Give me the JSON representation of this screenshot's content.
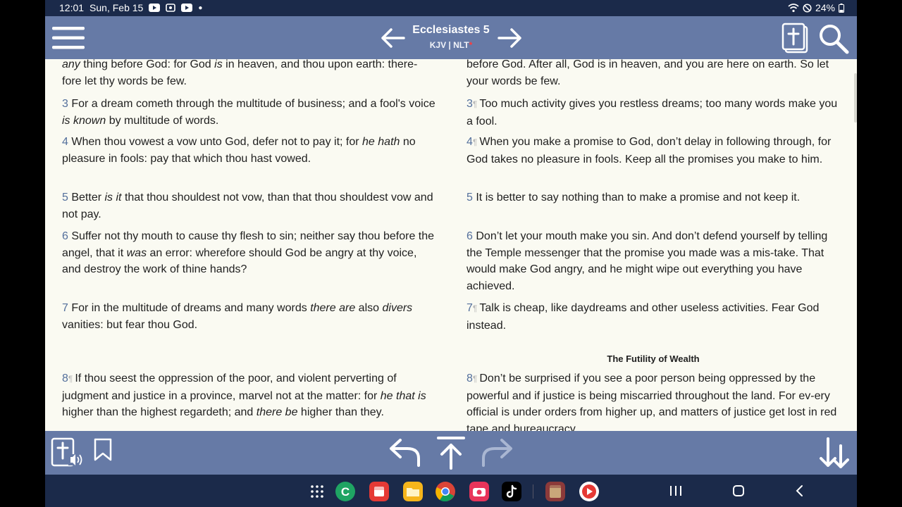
{
  "status_bar": {
    "time": "12:01",
    "date": "Sun, Feb 15",
    "battery": "24%"
  },
  "top_bar": {
    "chapter_title": "Ecclesiastes 5",
    "versions": "KJV | NLT",
    "version_marker": "*",
    "icons": [
      "menu-icon",
      "arrow-left-icon",
      "arrow-right-icon",
      "bible-book-icon",
      "search-icon"
    ]
  },
  "passage": {
    "kjv": [
      {
        "num": "",
        "html": "<i>any</i> thing before God: for God <i>is</i> in heaven, and thou upon earth: there-fore let thy words be few."
      },
      {
        "num": "3",
        "html": "For a dream cometh through the multitude of business; and a fool's voice <i>is known</i> by multitude of words."
      },
      {
        "num": "4",
        "html": "When thou vowest a vow unto God, defer not to pay it; for <i>he hath</i> no pleasure in fools: pay that which thou hast vowed."
      },
      {
        "num": "5",
        "html": "Better <i>is it</i> that thou shouldest not vow, than that thou shouldest vow and not pay."
      },
      {
        "num": "6",
        "html": "Suffer not thy mouth to cause thy flesh to sin; neither say thou before the angel, that it <i>was</i> an error: wherefore should God be angry at thy voice, and destroy the work of thine hands?"
      },
      {
        "num": "7",
        "html": "For in the multitude of dreams and many words <i>there are</i> also <i>divers</i> vanities: but fear thou God."
      },
      {
        "num": "8",
        "pilcrow": true,
        "html": "If thou seest the oppression of the poor, and violent perverting of judgment and justice in a province, marvel not at the matter: for <i>he that is</i> higher than the highest regardeth; and <i>there be</i> higher than they."
      }
    ],
    "nlt": [
      {
        "num": "",
        "html": "before God. After all, God is in heaven, and you are here on earth. So let your words be few."
      },
      {
        "num": "3",
        "pilcrow": true,
        "html": "Too much activity gives you restless dreams; too many words make you a fool."
      },
      {
        "num": "4",
        "pilcrow": true,
        "html": "When you make a promise to God, don’t delay in following through, for God takes no pleasure in fools. Keep all the promises you make to him."
      },
      {
        "num": "5",
        "html": "It is better to say nothing than to make a promise and not keep it."
      },
      {
        "num": "6",
        "html": "Don’t let your mouth make you sin. And don’t defend yourself by telling the Temple messenger that the promise you made was a mis-take. That would make God angry, and he might wipe out everything you have achieved."
      },
      {
        "num": "7",
        "pilcrow": true,
        "html": "Talk is cheap, like daydreams and other useless activities. Fear God instead."
      },
      {
        "num": "8",
        "pilcrow": true,
        "html": "Don’t be surprised if you see a poor person being oppressed by the powerful and if justice is being miscarried throughout the land. For ev-ery official is under orders from higher up, and matters of justice get lost in red tape and bureaucracy."
      }
    ],
    "nlt_heading": "The Futility of Wealth",
    "pilcrow_char": "¶"
  },
  "bottom_bar": {
    "icons": [
      "bible-audio-icon",
      "bookmark-icon",
      "undo-icon",
      "scroll-top-icon",
      "redo-icon",
      "sort-down-icon"
    ]
  },
  "nav_bar": {
    "apps": [
      "app-grid-icon",
      "phone-app-icon",
      "notes-app-icon",
      "files-app-icon",
      "chrome-app-icon",
      "camera-app-icon",
      "tiktok-app-icon",
      "bible-app-icon",
      "screen-recorder-app-icon"
    ],
    "buttons": [
      "recents-button",
      "home-button",
      "back-button"
    ]
  }
}
